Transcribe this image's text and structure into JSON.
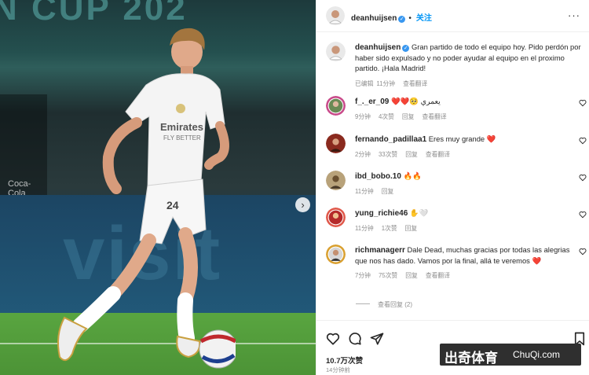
{
  "photo": {
    "banner_text": "N CUP 202",
    "board_text": "visit",
    "left_ad_lines": [
      "Coca-Cola"
    ],
    "shirt_sponsor": "Emirates",
    "shirt_slogan": "FLY BETTER",
    "shirt_number": "24"
  },
  "header": {
    "username": "deanhuijsen",
    "follow_label": "关注",
    "more_label": "···"
  },
  "caption": {
    "username": "deanhuijsen",
    "text": "Gran partido de todo el equipo hoy. Pido perdón por haber sido expulsado y no poder ayudar al equipo en el proximo partido. ¡Hala Madrid!",
    "edited": "已编辑",
    "time": "11分钟",
    "translate": "查看翻译"
  },
  "comments": [
    {
      "username": "f_._er_09",
      "text": "❤️❤️🥺 يعمري",
      "time": "9分钟",
      "likes": "4次赞",
      "reply": "回复",
      "translate": "查看翻译"
    },
    {
      "username": "fernando_padillaa1",
      "text": "Eres muy grande ❤️",
      "time": "2分钟",
      "likes": "33次赞",
      "reply": "回复",
      "translate": "查看翻译"
    },
    {
      "username": "ibd_bobo.10",
      "text": "🔥🔥",
      "time": "11分钟",
      "likes": "",
      "reply": "回复",
      "translate": ""
    },
    {
      "username": "yung_richie46",
      "text": "✋🤍",
      "time": "11分钟",
      "likes": "1次赞",
      "reply": "回复",
      "translate": ""
    },
    {
      "username": "richmanagerr",
      "text": "Dale Dead, muchas gracias por todas las alegrias que nos has dado. Vamos por la final, allá te veremos ❤️",
      "time": "7分钟",
      "likes": "75次赞",
      "reply": "回复",
      "translate": "查看翻译"
    }
  ],
  "view_replies": "查看回复 (2)",
  "footer": {
    "likes": "10.7万次赞",
    "time": "14分钟前"
  },
  "watermark": {
    "cn": "出奇体育",
    "en": "ChuQi.com"
  },
  "colors": {
    "accent": "#0095f6",
    "verified": "#3897f0",
    "muted": "#8e8e8e"
  }
}
